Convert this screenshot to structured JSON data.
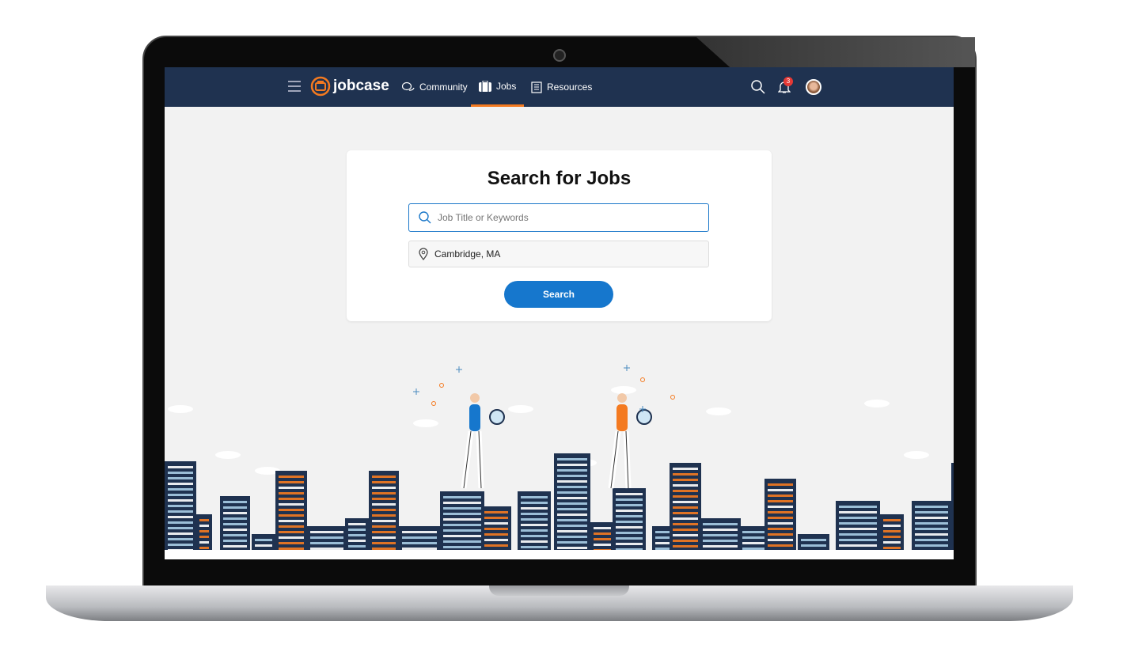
{
  "nav": {
    "brand": "jobcase",
    "items": [
      {
        "label": "Community",
        "icon": "chat-bubbles-icon"
      },
      {
        "label": "Jobs",
        "icon": "briefcase-icon",
        "active": true
      },
      {
        "label": "Resources",
        "icon": "book-icon"
      }
    ],
    "notification_count": "3"
  },
  "search": {
    "title": "Search for Jobs",
    "keyword_placeholder": "Job Title or Keywords",
    "keyword_value": "",
    "location_value": "Cambridge, MA",
    "button_label": "Search"
  },
  "colors": {
    "nav_bg": "#1f3250",
    "accent": "#f47a20",
    "button": "#1677cd"
  }
}
